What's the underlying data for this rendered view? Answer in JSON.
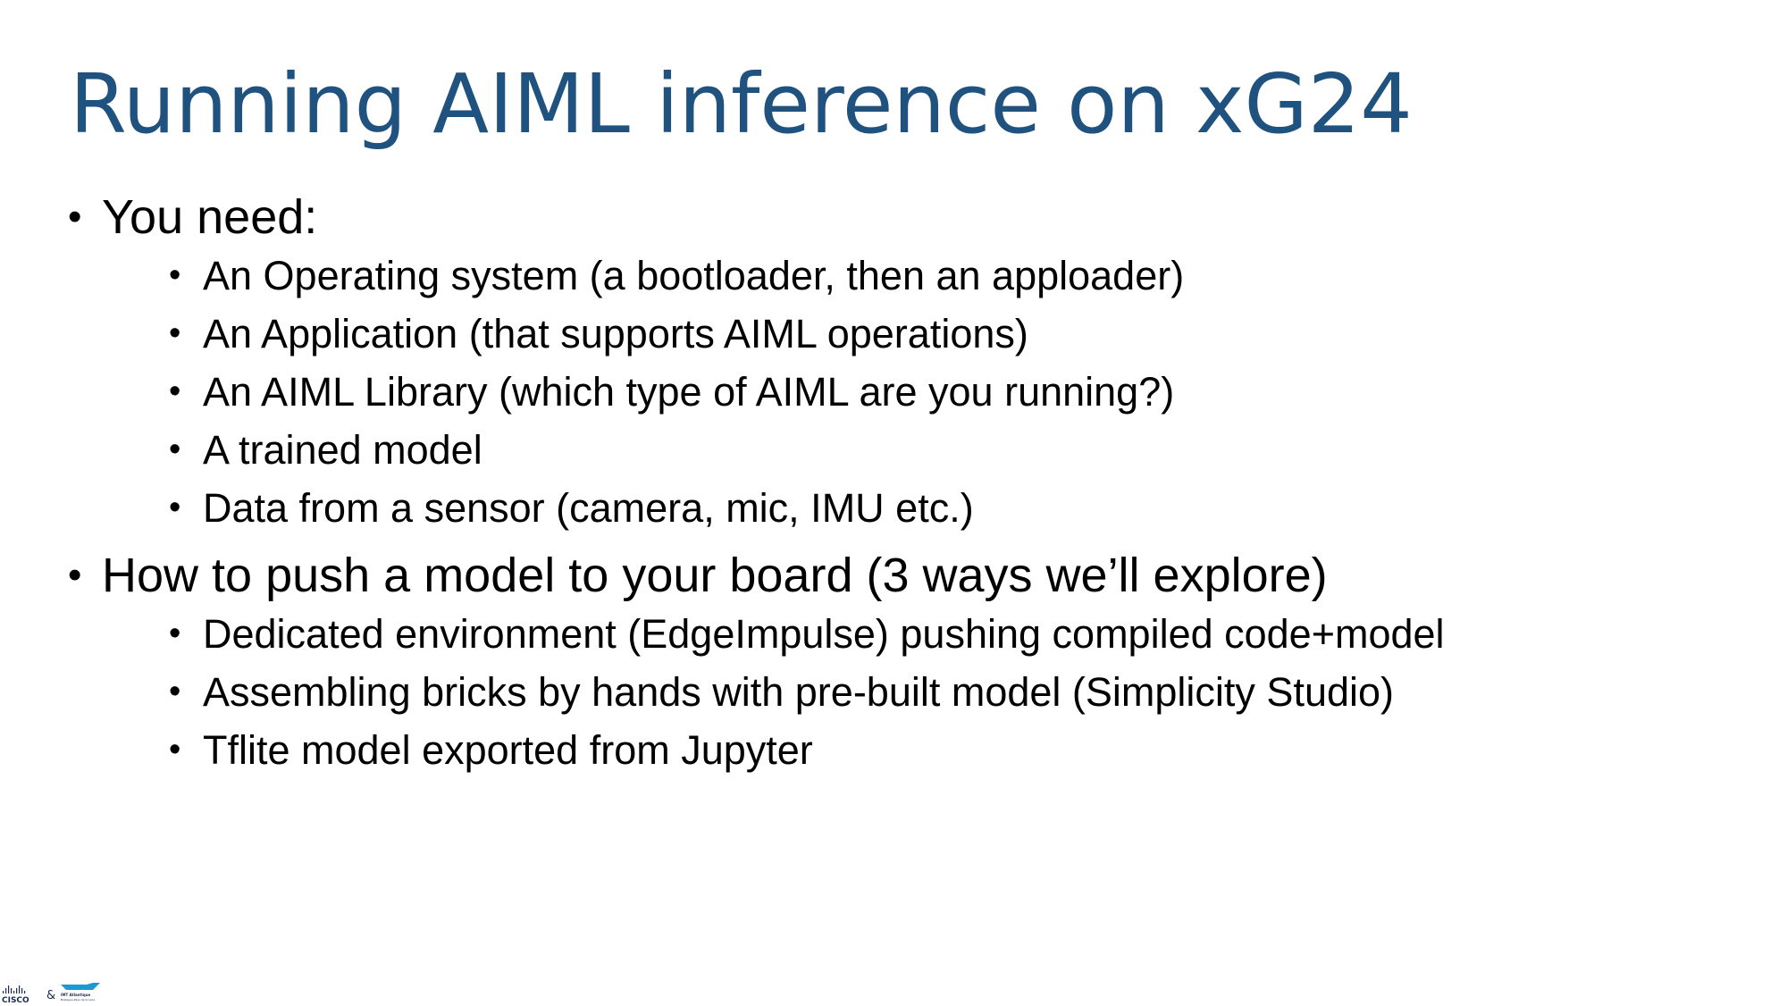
{
  "slide": {
    "title": "Running AIML inference on xG24",
    "bullets": [
      {
        "text": "You need:",
        "sub": [
          "An Operating system (a bootloader, then an apploader)",
          "An Application (that supports AIML operations)",
          "An AIML Library (which type of AIML are you running?)",
          "A trained model",
          "Data from a sensor (camera, mic, IMU etc.)"
        ]
      },
      {
        "text": "How to push a model to your board (3 ways we’ll explore)",
        "sub": [
          "Dedicated environment (EdgeImpulse) pushing compiled code+model",
          "Assembling bricks by hands with pre-built model (Simplicity Studio)",
          "Tflite model exported from Jupyter"
        ]
      }
    ]
  },
  "footer": {
    "logo_left_text": "CISCO",
    "logo_joiner": "&",
    "logo_right_text": "IMT Atlantique",
    "logo_right_caption": "Bretagne-Pays de la Loire"
  },
  "colors": {
    "title": "#1f527f",
    "text": "#000000",
    "logo_blue": "#1c9ad6",
    "logo_dark": "#1d2b4f"
  }
}
